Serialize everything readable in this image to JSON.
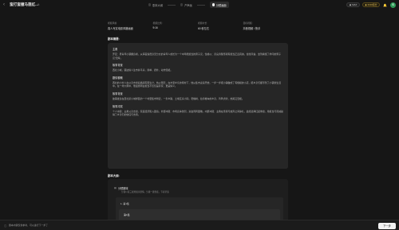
{
  "header": {
    "title": "蛮打蛮撞马莲红...",
    "steps": [
      {
        "label": "剧本大纲",
        "active": false
      },
      {
        "label": "产声画",
        "active": false
      },
      {
        "label": "分镜画面",
        "active": true
      }
    ],
    "pills": [
      {
        "label": "MAX",
        "icon": "◆"
      },
      {
        "label": "6000积分",
        "icon": "◆"
      }
    ],
    "avatar_letter": "S"
  },
  "meta": [
    {
      "label": "视频风格:",
      "value": "真人写实电影风格画面"
    },
    {
      "label": "视频比例:",
      "value": "9:16"
    },
    {
      "label": "视频时长:",
      "value": "60 秒左右"
    },
    {
      "label": "目标视频:",
      "value": "抖音视频 / 快手"
    }
  ],
  "synopsis": {
    "section_title": "剧本摘要:",
    "blocks": [
      {
        "heading": "主角",
        "text": "罗定：男青年小镇翻身者，从挥霍浪费身无分文的青年人成长为一个中年能担当的男子汉，性格以：善良清醒坚韧有担当正直真诚，甘愿风霜，坐到看懂了学问的男子汉'无悔'。"
      },
      {
        "heading": "故事背景",
        "text": "西北小城，镇边缘人生市井平房，简单，质朴，动作温暖。"
      },
      {
        "heading": "剧情梗概",
        "text": "西北的小伙人在父亲去世后挑起家里生计，热火朝天，在乡里乡亲的帮衬下，他从集市卖菜开始，一步一步把小铺做成了有规模的小店，把乡亲们都带到了小镇新生活中。在一场大雨中，他最终明白担当不仅仅是养家，更是情义。"
      },
      {
        "heading": "故事背景",
        "text": "故事发生在西北某小城郊区的一个村里集市附近，一条乡路，土墙瓦房小院，老槐树，拉手推车的乡亲，鸡鸭犬吠，热闹又温暖。"
      },
      {
        "heading": "故事冲突",
        "text": "个人冲突：主角父亲去世，家庭经济陷入困境。外部冲突：市场竞争激烈，资金周转困难。内部冲突：主角在坚持与放弃之间挣扎，最终选择扛起重担，用担当与真诚赢得了乡亲们的信任与支持。"
      }
    ]
  },
  "outline": {
    "section_title": "剧本大纲:",
    "title": "分镜脚本",
    "subtitle": "分镜以第三视角展示剧情，分镜一镜到底，节奏紧凑",
    "episode_label": "1. 第1集",
    "scene_label": "第1集"
  },
  "footer": {
    "tip": "剧本内容仅供参考，可以进行下一步了",
    "next_label": "下一步"
  }
}
